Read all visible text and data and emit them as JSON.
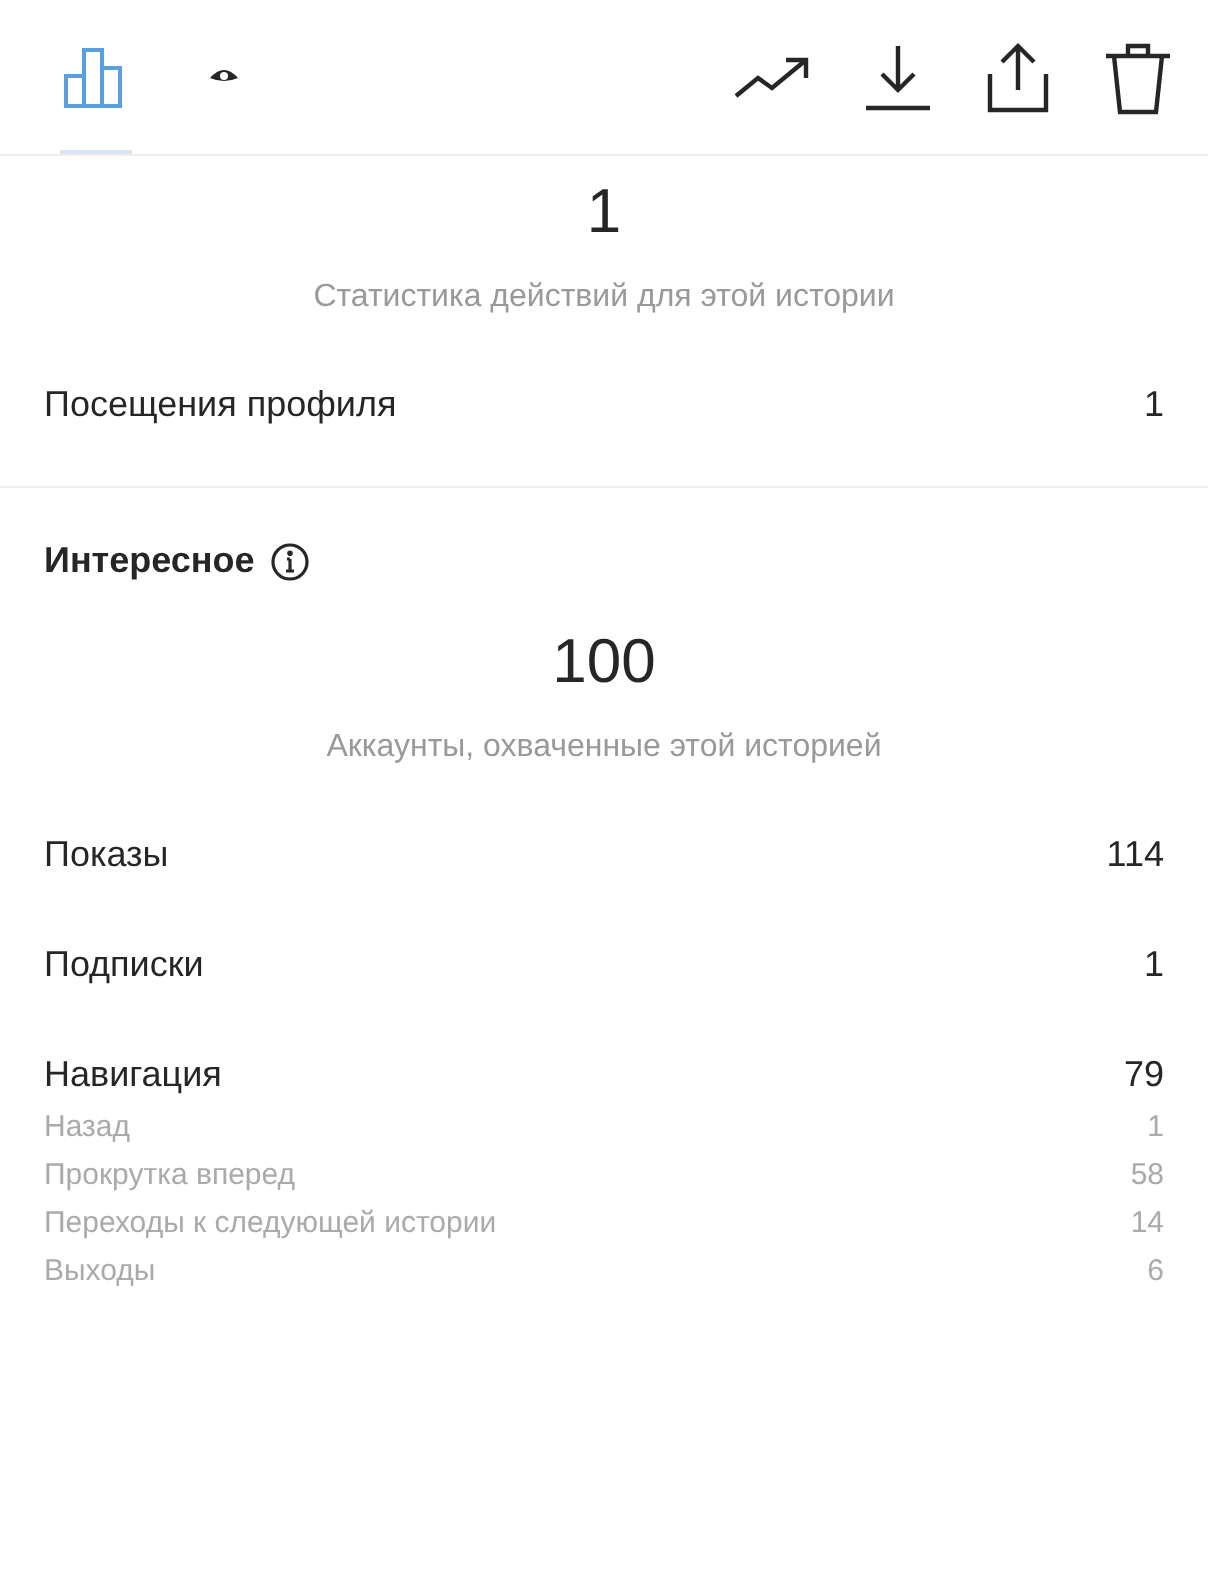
{
  "tabs": [
    {
      "kind": "chart",
      "selected": true
    },
    {
      "kind": "eye",
      "selected": false
    }
  ],
  "actions": [
    {
      "kind": "trend"
    },
    {
      "kind": "download"
    },
    {
      "kind": "share"
    },
    {
      "kind": "delete"
    }
  ],
  "actions_section": {
    "value": "1",
    "caption": "Статистика действий для этой истории",
    "rows": [
      {
        "label": "Посещения профиля",
        "value": "1"
      }
    ]
  },
  "discovery": {
    "title": "Интересное",
    "value": "100",
    "caption": "Аккаунты, охваченные этой историей",
    "rows": [
      {
        "label": "Показы",
        "value": "114"
      },
      {
        "label": "Подписки",
        "value": "1"
      },
      {
        "label": "Навигация",
        "value": "79",
        "children": [
          {
            "label": "Назад",
            "value": "1"
          },
          {
            "label": "Прокрутка вперед",
            "value": "58"
          },
          {
            "label": "Переходы к следующей истории",
            "value": "14"
          },
          {
            "label": "Выходы",
            "value": "6"
          }
        ]
      }
    ]
  }
}
